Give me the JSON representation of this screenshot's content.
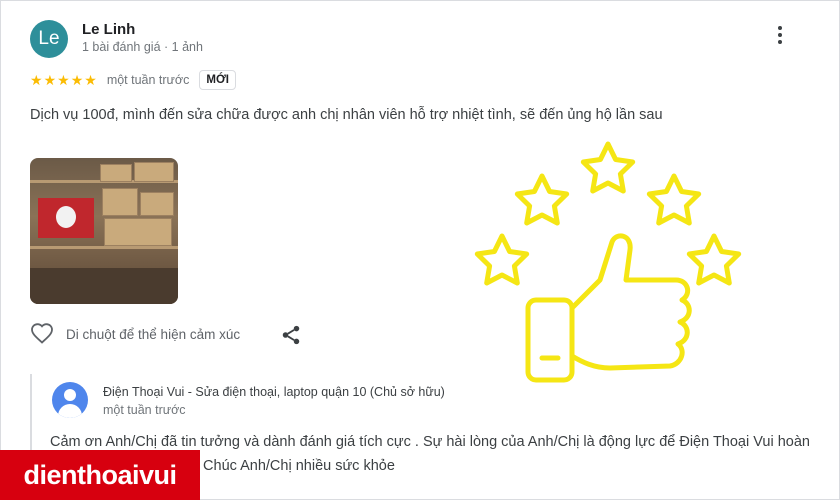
{
  "review": {
    "avatar_initials": "Le",
    "reviewer_name": "Le Linh",
    "reviewer_meta": "1 bài đánh giá · 1 ảnh",
    "rating": 5,
    "rating_max": 5,
    "time": "một tuần trước",
    "badge": "MỚI",
    "text": "Dịch vụ 100đ, mình đến sửa chữa được anh chị nhân viên hỗ trợ nhiệt tình, sẽ đến ủng hộ lần sau",
    "reaction_label": "Di chuột để thể hiện cảm xúc"
  },
  "owner_reply": {
    "name": "Điện Thoại Vui - Sửa điện thoại, laptop quận 10 (Chủ sở hữu)",
    "time": "một tuần trước",
    "text": "Cảm ơn Anh/Chị đã tin tưởng và dành đánh giá tích cực . Sự hài lòng của Anh/Chị là động lực để Điện Thoại Vui hoàn thiện dịch vụ hơn nữa . Chúc Anh/Chị nhiều sức khỏe"
  },
  "brand": {
    "logo_text": "dienthoaivui"
  },
  "colors": {
    "star": "#fbbc04",
    "avatar": "#2e8f9a",
    "owner_avatar": "#4f86ec",
    "brand_red": "#d7000f",
    "decoration_yellow": "#f5e614"
  },
  "icons": [
    "more-vert-icon",
    "star-icon",
    "heart-icon",
    "share-icon",
    "person-icon",
    "thumbs-up-icon"
  ]
}
